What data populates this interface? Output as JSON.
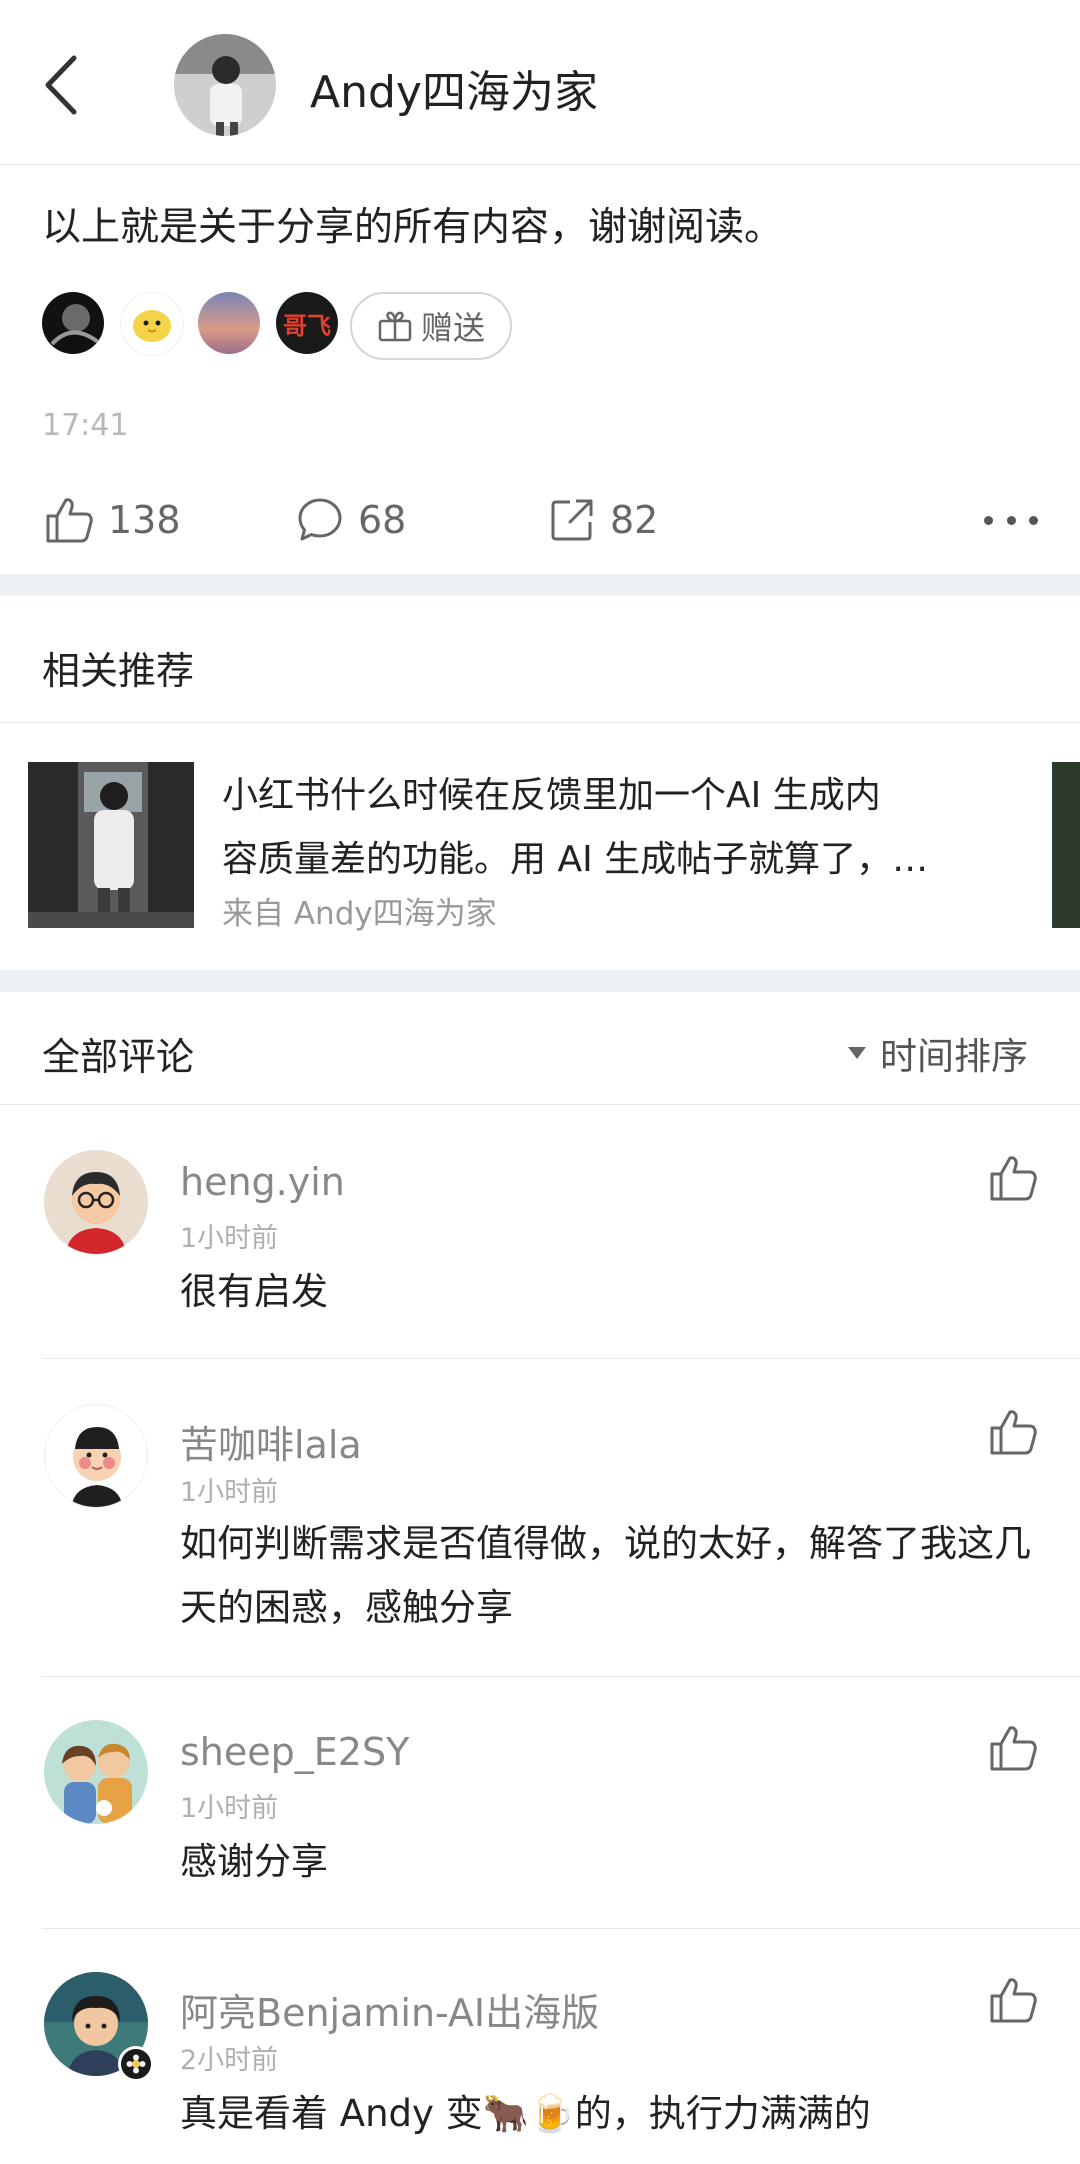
{
  "header": {
    "back_icon": "chevron-left-icon",
    "author_name": "Andy四海为家"
  },
  "post": {
    "text": "以上就是关于分享的所有内容，谢谢阅读。",
    "gifter_badge_text": "哥飞",
    "gift_button_label": "赠送",
    "time": "17:41",
    "likes": "138",
    "comments": "68",
    "shares": "82"
  },
  "related": {
    "title": "相关推荐",
    "items": [
      {
        "line1": "小红书什么时候在反馈里加一个AI 生成内",
        "line2": "容质量差的功能。用 AI 生成帖子就算了，…",
        "from": "来自 Andy四海为家"
      }
    ]
  },
  "comments_section": {
    "title": "全部评论",
    "sort_label": "时间排序",
    "items": [
      {
        "name": "heng.yin",
        "time": "1小时前",
        "text": "很有启发"
      },
      {
        "name": "苦咖啡lala",
        "time": "1小时前",
        "text": "如何判断需求是否值得做，说的太好，解答了我这几天的困惑，感触分享"
      },
      {
        "name": "sheep_E2SY",
        "time": "1小时前",
        "text": "感谢分享"
      },
      {
        "name": "阿亮Benjamin-AI出海版",
        "time": "2小时前",
        "text": "真是看着 Andy 变🐂🍺的，执行力满满的"
      }
    ]
  },
  "colors": {
    "separator_band": "#eef1f4",
    "secondary_text": "#888888",
    "timestamp": "#b0b0b0",
    "gifter_badge_text": "#e0412f"
  }
}
